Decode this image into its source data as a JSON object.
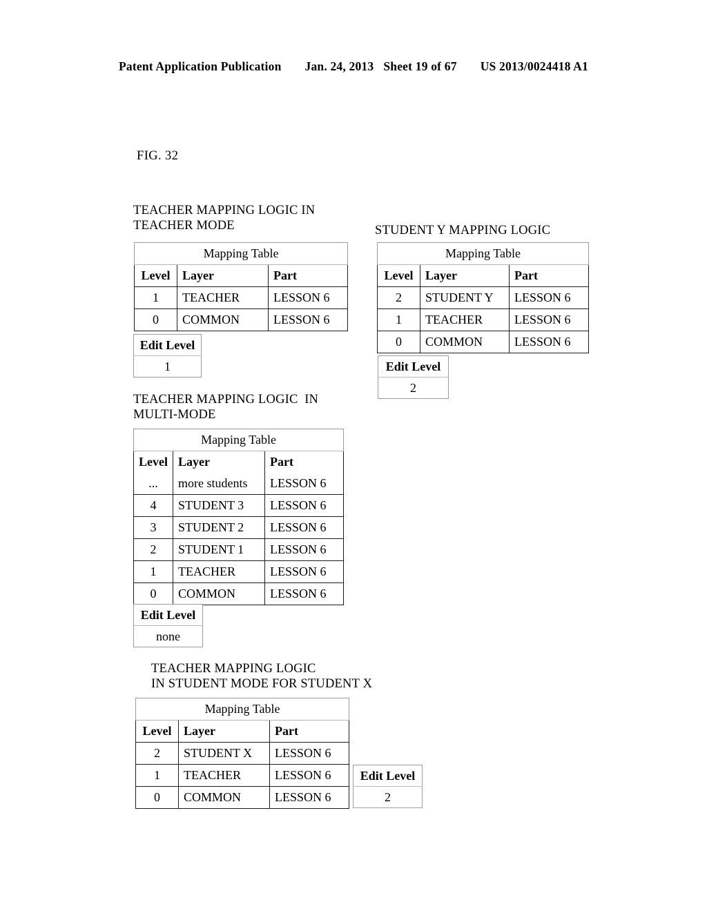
{
  "header": {
    "publication": "Patent Application Publication",
    "date": "Jan. 24, 2013",
    "sheet": "Sheet 19 of 67",
    "doc_number": "US 2013/0024418 A1"
  },
  "figure": {
    "label": "FIG. 32"
  },
  "sections": {
    "teacher_mode": {
      "caption": "TEACHER MAPPING LOGIC IN\nTEACHER MODE",
      "table": {
        "title": "Mapping Table",
        "columns": [
          "Level",
          "Layer",
          "Part"
        ],
        "rows": [
          [
            "1",
            "TEACHER",
            "LESSON 6"
          ],
          [
            "0",
            "COMMON",
            "LESSON 6"
          ]
        ]
      },
      "edit": {
        "label": "Edit Level",
        "value": "1"
      }
    },
    "student_y": {
      "caption": "STUDENT Y MAPPING LOGIC",
      "table": {
        "title": "Mapping Table",
        "columns": [
          "Level",
          "Layer",
          "Part"
        ],
        "rows": [
          [
            "2",
            "STUDENT Y",
            "LESSON 6"
          ],
          [
            "1",
            "TEACHER",
            "LESSON 6"
          ],
          [
            "0",
            "COMMON",
            "LESSON 6"
          ]
        ]
      },
      "edit": {
        "label": "Edit Level",
        "value": "2"
      }
    },
    "multi_mode": {
      "caption": "TEACHER MAPPING LOGIC  IN\nMULTI-MODE",
      "table": {
        "title": "Mapping Table",
        "columns": [
          "Level",
          "Layer",
          "Part"
        ],
        "ellipsis_row": [
          "...",
          "more students",
          "LESSON 6"
        ],
        "rows": [
          [
            "4",
            "STUDENT 3",
            "LESSON 6"
          ],
          [
            "3",
            "STUDENT 2",
            "LESSON 6"
          ],
          [
            "2",
            "STUDENT 1",
            "LESSON 6"
          ],
          [
            "1",
            "TEACHER",
            "LESSON 6"
          ],
          [
            "0",
            "COMMON",
            "LESSON 6"
          ]
        ]
      },
      "edit": {
        "label": "Edit Level",
        "value": "none"
      }
    },
    "student_x": {
      "caption": "TEACHER MAPPING LOGIC\nIN STUDENT MODE FOR STUDENT X",
      "table": {
        "title": "Mapping Table",
        "columns": [
          "Level",
          "Layer",
          "Part"
        ],
        "rows": [
          [
            "2",
            "STUDENT X",
            "LESSON 6"
          ],
          [
            "1",
            "TEACHER",
            "LESSON 6"
          ],
          [
            "0",
            "COMMON",
            "LESSON 6"
          ]
        ]
      },
      "edit": {
        "label": "Edit Level",
        "value": "2"
      }
    }
  }
}
